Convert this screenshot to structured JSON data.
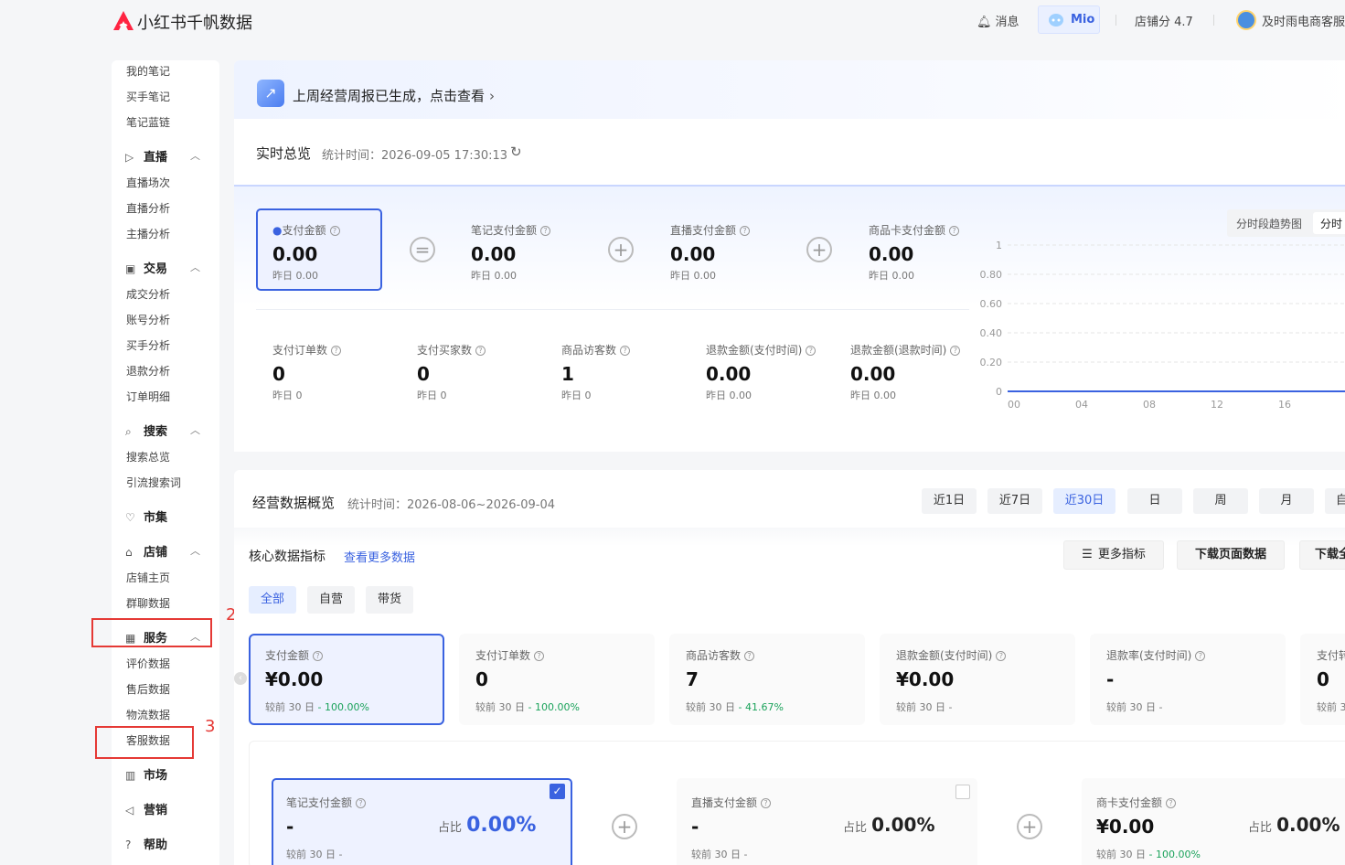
{
  "header": {
    "logo_text": "小红书千帆数据",
    "messages": "消息",
    "mio": "Mio",
    "shop_score": "店铺分 4.7",
    "account": "及时雨电商客服"
  },
  "sidebar": {
    "top_items": [
      "我的笔记",
      "买手笔记",
      "笔记蓝链"
    ],
    "groups": [
      {
        "label": "直播",
        "icon": "play-icon",
        "items": [
          "直播场次",
          "直播分析",
          "主播分析"
        ]
      },
      {
        "label": "交易",
        "icon": "trade-icon",
        "items": [
          "成交分析",
          "账号分析",
          "买手分析",
          "退款分析",
          "订单明细"
        ]
      },
      {
        "label": "搜索",
        "icon": "search-icon",
        "items": [
          "搜索总览",
          "引流搜索词"
        ]
      },
      {
        "label": "市集",
        "icon": "market-icon",
        "items": []
      },
      {
        "label": "店铺",
        "icon": "store-icon",
        "items": [
          "店铺主页",
          "群聊数据"
        ]
      },
      {
        "label": "服务",
        "icon": "grid-icon",
        "items": [
          "评价数据",
          "售后数据",
          "物流数据",
          "客服数据"
        ]
      },
      {
        "label": "市场",
        "icon": "chart-icon",
        "items": []
      },
      {
        "label": "营销",
        "icon": "megaphone-icon",
        "items": []
      },
      {
        "label": "帮助",
        "icon": "help-icon",
        "items": []
      }
    ],
    "annotation_2": "2",
    "annotation_3": "3"
  },
  "banner": {
    "text": "上周经营周报已生成，点击查看"
  },
  "realtime": {
    "title": "实时总览",
    "stat_time": "统计时间：2026-09-05 17:30:13",
    "metrics_top": [
      {
        "label": "支付金额",
        "value": "0.00",
        "yesterday": "昨日 0.00"
      },
      {
        "label": "笔记支付金额",
        "value": "0.00",
        "yesterday": "昨日 0.00"
      },
      {
        "label": "直播支付金额",
        "value": "0.00",
        "yesterday": "昨日 0.00"
      },
      {
        "label": "商品卡支付金额",
        "value": "0.00",
        "yesterday": "昨日 0.00"
      }
    ],
    "operators": [
      "=",
      "+",
      "+"
    ],
    "metrics_bottom": [
      {
        "label": "支付订单数",
        "value": "0",
        "yesterday": "昨日 0"
      },
      {
        "label": "支付买家数",
        "value": "0",
        "yesterday": "昨日 0"
      },
      {
        "label": "商品访客数",
        "value": "1",
        "yesterday": "昨日 0"
      },
      {
        "label": "退款金额(支付时间)",
        "value": "0.00",
        "yesterday": "昨日 0.00"
      },
      {
        "label": "退款金额(退款时间)",
        "value": "0.00",
        "yesterday": "昨日 0.00"
      }
    ],
    "chart_tabs": [
      "分时段趋势图",
      "分时"
    ]
  },
  "chart_data": {
    "type": "line",
    "x": [
      "00",
      "04",
      "08",
      "12",
      "16",
      "2"
    ],
    "y_ticks": [
      "1",
      "0.80",
      "0.60",
      "0.40",
      "0.20",
      "0"
    ],
    "ylim": [
      0,
      1
    ],
    "series": [
      {
        "values": [
          0,
          0,
          0,
          0,
          0,
          0
        ]
      }
    ],
    "series_color": "#3a62e0",
    "grid": true
  },
  "overview": {
    "title": "经营数据概览",
    "stat_time": "统计时间：2026-08-06~2026-09-04",
    "range_buttons": [
      "近1日",
      "近7日",
      "近30日",
      "日",
      "周",
      "月",
      "自"
    ],
    "active_range": "近30日",
    "core_title": "核心数据指标",
    "more_link": "查看更多数据",
    "more_metrics": "更多指标",
    "download_page": "下载页面数据",
    "download_other": "下载全",
    "filter_tabs": [
      "全部",
      "自营",
      "带货"
    ],
    "kpis": [
      {
        "label": "支付金额",
        "value": "¥0.00",
        "compare": "较前 30 日",
        "delta": "- 100.00%"
      },
      {
        "label": "支付订单数",
        "value": "0",
        "compare": "较前 30 日",
        "delta": "- 100.00%"
      },
      {
        "label": "商品访客数",
        "value": "7",
        "compare": "较前 30 日",
        "delta": "- 41.67%"
      },
      {
        "label": "退款金额(支付时间)",
        "value": "¥0.00",
        "compare": "较前 30 日",
        "delta": "-"
      },
      {
        "label": "退款率(支付时间)",
        "value": "-",
        "compare": "较前 30 日",
        "delta": "-"
      },
      {
        "label": "支付转",
        "value": "0",
        "compare": "较前 3",
        "delta": ""
      }
    ],
    "breakdown": [
      {
        "label": "笔记支付金额",
        "value": "-",
        "ratio_label": "占比",
        "ratio": "0.00%",
        "compare": "较前 30 日",
        "delta": "-"
      },
      {
        "label": "直播支付金额",
        "value": "-",
        "ratio_label": "占比",
        "ratio": "0.00%",
        "compare": "较前 30 日",
        "delta": "-"
      },
      {
        "label": "商卡支付金额",
        "value": "¥0.00",
        "ratio_label": "占比",
        "ratio": "0.00%",
        "compare": "较前 30 日",
        "delta": "- 100.00%"
      }
    ],
    "plus": "+"
  },
  "colors": {
    "accent": "#3a62e0",
    "positive": "#1aa25a",
    "annotation": "#e53935"
  }
}
